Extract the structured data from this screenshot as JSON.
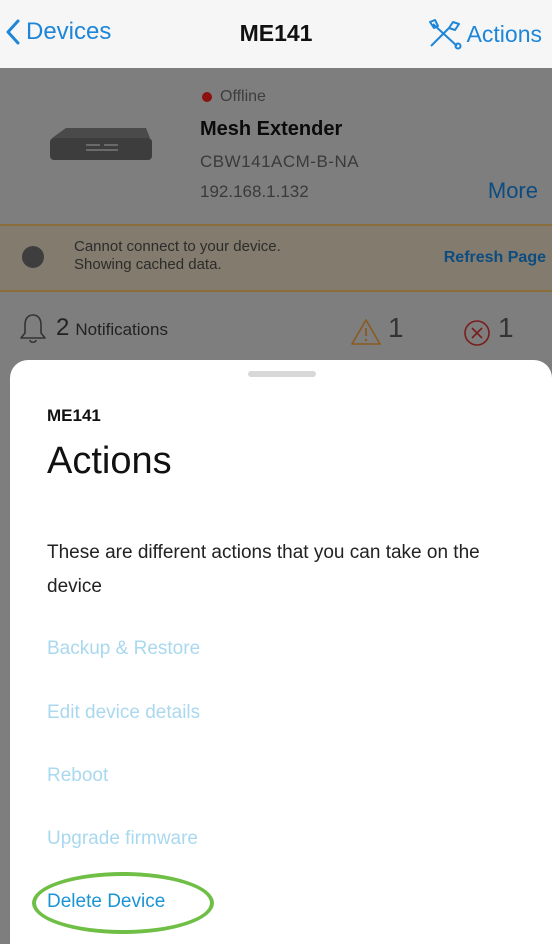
{
  "nav": {
    "back_label": "Devices",
    "title": "ME141",
    "actions_label": "Actions",
    "accent_color": "#1d86d9"
  },
  "device": {
    "status": "Offline",
    "name": "Mesh Extender",
    "model": "CBW141ACM-B-NA",
    "ip": "192.168.1.132",
    "more_label": "More"
  },
  "banner": {
    "line1": "Cannot connect to your device.",
    "line2": "Showing cached data.",
    "refresh_label": "Refresh Page"
  },
  "notifications": {
    "count": "2",
    "label": "Notifications",
    "warnings": "1",
    "errors": "1"
  },
  "sheet": {
    "subtitle": "ME141",
    "title": "Actions",
    "description": "These are different actions that you can take on the device",
    "actions": [
      {
        "label": "Backup & Restore"
      },
      {
        "label": "Edit device details"
      },
      {
        "label": "Reboot"
      },
      {
        "label": "Upgrade firmware"
      },
      {
        "label": "Delete Device"
      }
    ],
    "highlight_color": "#6fbe45"
  }
}
